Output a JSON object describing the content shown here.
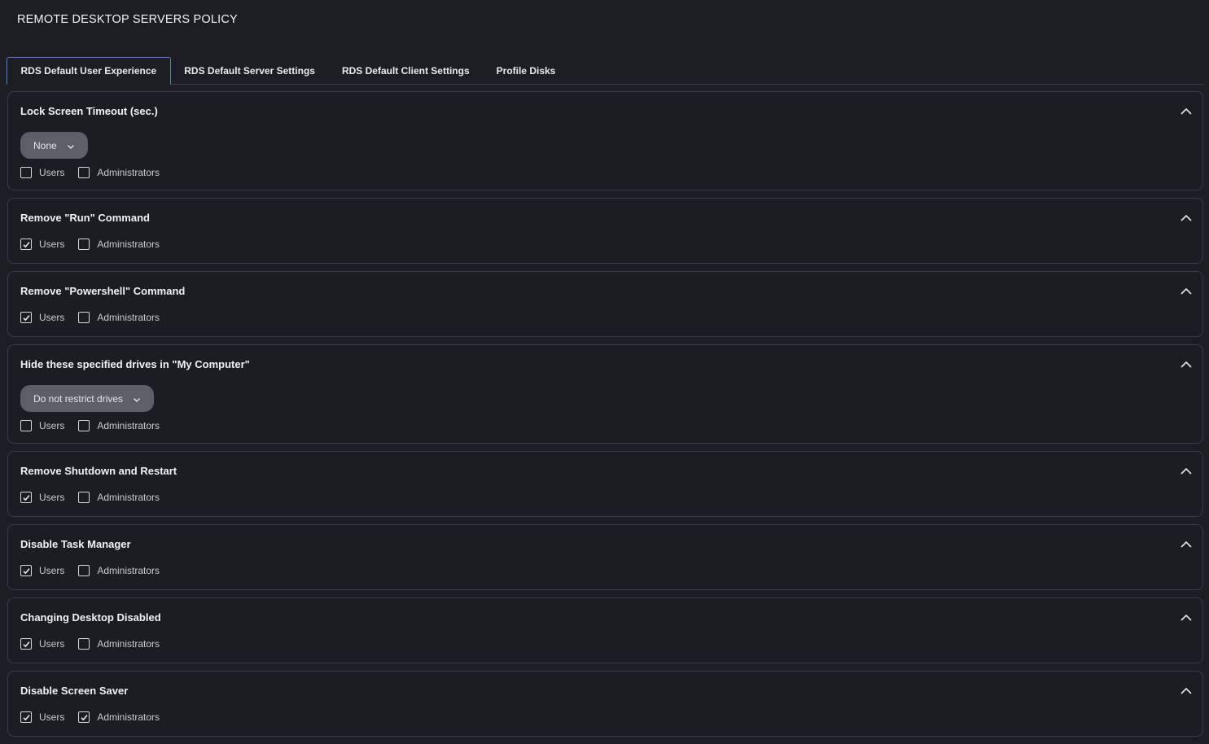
{
  "page": {
    "title": "REMOTE DESKTOP SERVERS POLICY"
  },
  "tabs": [
    {
      "label": "RDS Default User Experience",
      "active": true
    },
    {
      "label": "RDS Default Server Settings",
      "active": false
    },
    {
      "label": "RDS Default Client Settings",
      "active": false
    },
    {
      "label": "Profile Disks",
      "active": false
    }
  ],
  "icons": {
    "collapse": "chevron-up-icon",
    "dropdown": "chevron-down-icon",
    "check": "checkmark-icon"
  },
  "colors": {
    "background": "#1d1e23",
    "panel_border": "#3a3c44",
    "active_tab_border": "#5d7fb8",
    "dropdown_bg": "#5c5f66"
  },
  "policies": [
    {
      "title": "Lock Screen Timeout (sec.)",
      "dropdown": "None",
      "users_label": "Users",
      "users_checked": false,
      "admins_label": "Administrators",
      "admins_checked": false
    },
    {
      "title": "Remove \"Run\" Command",
      "users_label": "Users",
      "users_checked": true,
      "admins_label": "Administrators",
      "admins_checked": false
    },
    {
      "title": "Remove \"Powershell\" Command",
      "users_label": "Users",
      "users_checked": true,
      "admins_label": "Administrators",
      "admins_checked": false
    },
    {
      "title": "Hide these specified drives in \"My Computer\"",
      "dropdown": "Do not restrict drives",
      "users_label": "Users",
      "users_checked": false,
      "admins_label": "Administrators",
      "admins_checked": false
    },
    {
      "title": "Remove Shutdown and Restart",
      "users_label": "Users",
      "users_checked": true,
      "admins_label": "Administrators",
      "admins_checked": false
    },
    {
      "title": "Disable Task Manager",
      "users_label": "Users",
      "users_checked": true,
      "admins_label": "Administrators",
      "admins_checked": false
    },
    {
      "title": "Changing Desktop Disabled",
      "users_label": "Users",
      "users_checked": true,
      "admins_label": "Administrators",
      "admins_checked": false
    },
    {
      "title": "Disable Screen Saver",
      "users_label": "Users",
      "users_checked": true,
      "admins_label": "Administrators",
      "admins_checked": true
    }
  ]
}
